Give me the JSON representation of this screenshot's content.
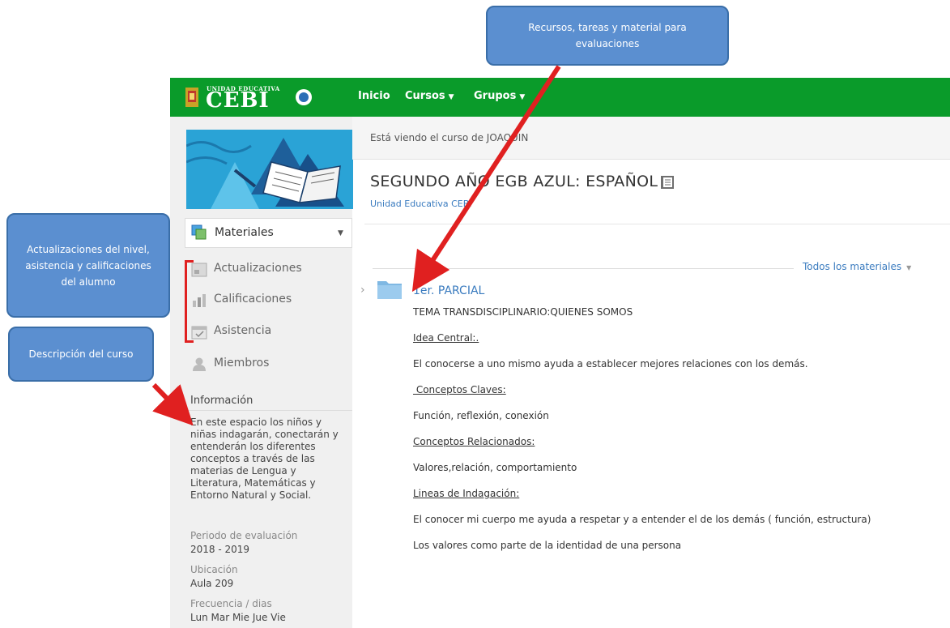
{
  "topbar": {
    "logo_small": "UNIDAD EDUCATIVA",
    "logo_big": "CEBI",
    "nav": [
      {
        "label": "Inicio"
      },
      {
        "label": "Cursos"
      },
      {
        "label": "Grupos"
      }
    ]
  },
  "sidebar": {
    "materials_label": "Materiales",
    "items": [
      {
        "label": "Actualizaciones"
      },
      {
        "label": "Calificaciones"
      },
      {
        "label": "Asistencia"
      },
      {
        "label": "Miembros"
      }
    ],
    "info_title": "Información",
    "info_desc": "En este espacio los niños y niñas indagarán, conectarán y entenderán los diferentes conceptos a través de las materias de Lengua y Literatura, Matemáticas y Entorno Natural y Social.",
    "meta": [
      {
        "label": "Periodo de evaluación",
        "value": "2018 - 2019"
      },
      {
        "label": "Ubicación",
        "value": "Aula 209"
      },
      {
        "label": "Frecuencia / dias",
        "value": "Lun Mar Mie Jue Vie"
      }
    ]
  },
  "main": {
    "viewing_text": "Está viendo el curso de JOAQUIN",
    "course_title": "SEGUNDO AÑO EGB AZUL: ESPAÑOL",
    "school": "Unidad Educativa CEBI",
    "filter_label": "Todos los materiales",
    "folder_title": "1er. PARCIAL",
    "content": [
      "TEMA TRANSDISCIPLINARIO:QUIENES SOMOS",
      "Idea Central:.",
      "El conocerse  a uno mismo ayuda a establecer mejores relaciones con los demás.",
      " Conceptos Claves:",
      "Función, reflexión, conexión",
      "Conceptos Relacionados:",
      "Valores,relación, comportamiento",
      "Lineas de Indagación:",
      "El conocer mi cuerpo me ayuda a respetar y a entender el de los demás ( función, estructura)",
      "Los valores  como parte de la identidad de una persona"
    ]
  },
  "callouts": {
    "resources": "Recursos, tareas y material para evaluaciones",
    "updates": "Actualizaciones  del nivel, asistencia y calificaciones del alumno",
    "description": "Descripción del curso"
  },
  "colors": {
    "topbar": "#0a9b2a",
    "link": "#3a7bbf",
    "callout": "#5b8fd0",
    "arrow": "#e02020"
  }
}
